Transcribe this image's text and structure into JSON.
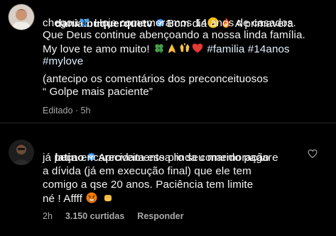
{
  "post": {
    "username": "danialbuquerquetv",
    "line1_a": "Bom dia",
    "line1_b": "A primavera",
    "line2_a": "chegou",
    "line2_b": "Hoje comemoramos 14 anos de casados.",
    "line3": "Que Deus continue abençoando a nossa linda família.",
    "line4_a": "My love te amo muito!",
    "line4_tags": "#familia #14anos",
    "line5_tag": "#mylove",
    "line6": "(antecipo os comentários dos preconceituosos",
    "line7": "“ Golpe mais paciente”",
    "edited": "Editado · 5h"
  },
  "comment": {
    "username": "latino",
    "line1": "Aproveita essa linda comemoração e",
    "line2": "já peça encarecidamente pro seu marido pagar",
    "line3": "a dívida (já em execução final) que ele tem",
    "line4": "comigo a qse 20 anos. Paciência tem limite",
    "line5": "né ! Affff",
    "time": "2h",
    "likes": "3.150 curtidas",
    "reply": "Responder"
  },
  "colors": {
    "background": "#000000",
    "text": "#f5f5f5",
    "meta": "#a8a8a8",
    "verified": "#3897f0",
    "divider": "#262626"
  },
  "icons": {
    "verified": "verified-badge-icon",
    "heart": "heart-outline-icon"
  }
}
